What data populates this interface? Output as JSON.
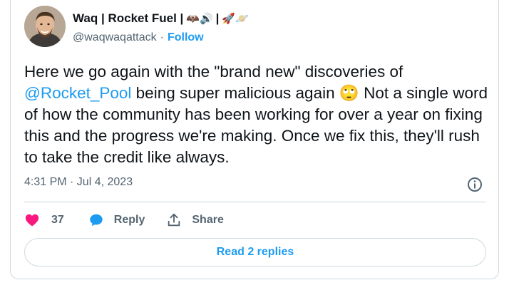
{
  "author": {
    "display_name": "Waq | Rocket Fuel |",
    "name_emoji_a": "🦇🔊",
    "separator": "|",
    "name_emoji_b": "🚀🪐",
    "handle": "@waqwaqattack",
    "dot": "·",
    "follow_label": "Follow"
  },
  "tweet": {
    "text_before": "Here we go again with the \"brand new\" discoveries of ",
    "mention": "@Rocket_Pool",
    "text_middle": " being super malicious again ",
    "emoji": "🙄",
    "text_after": " Not a single word of how the community has been working for over a year on fixing this and the progress we're making. Once we fix this, they'll rush to take the credit like always.",
    "timestamp": "4:31 PM · Jul 4, 2023"
  },
  "actions": {
    "like_count": "37",
    "reply_label": "Reply",
    "share_label": "Share"
  },
  "read_replies_label": "Read 2 replies",
  "colors": {
    "accent": "#1d9bf0",
    "like": "#f91880",
    "text": "#0f1419",
    "muted": "#536471",
    "border": "#cfd9de"
  },
  "icons": [
    "heart-icon",
    "reply-bubble-icon",
    "share-icon",
    "info-icon"
  ]
}
